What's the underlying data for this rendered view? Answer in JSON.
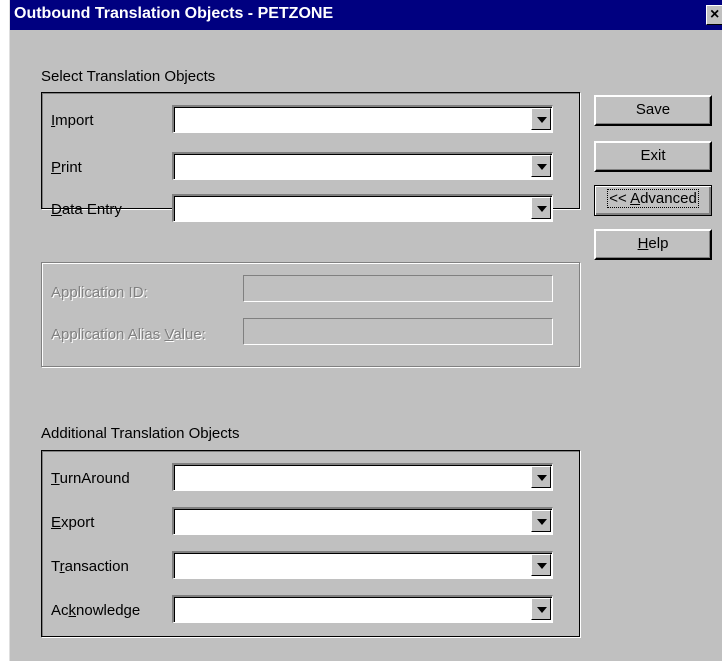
{
  "window": {
    "title": "Outbound Translation Objects - PETZONE",
    "close_glyph": "×"
  },
  "select_group": {
    "heading": "Select Translation Objects",
    "rows": [
      {
        "label_pre": "",
        "label_mnemonic": "I",
        "label_post": "mport",
        "value": ""
      },
      {
        "label_pre": "",
        "label_mnemonic": "P",
        "label_post": "rint",
        "value": ""
      },
      {
        "label_pre": "",
        "label_mnemonic": "D",
        "label_post": "ata Entry",
        "value": ""
      }
    ]
  },
  "application_group": {
    "app_id_label": "Application ID:",
    "alias_pre": "Application Alias ",
    "alias_mnemonic": "V",
    "alias_post": "alue:",
    "app_id_value": "",
    "alias_value": ""
  },
  "additional_group": {
    "heading": "Additional Translation Objects",
    "rows": [
      {
        "label_pre": "",
        "label_mnemonic": "T",
        "label_post": "urnAround",
        "value": ""
      },
      {
        "label_pre": "",
        "label_mnemonic": "E",
        "label_post": "xport",
        "value": ""
      },
      {
        "label_pre": "T",
        "label_mnemonic": "r",
        "label_post": "ansaction",
        "value": ""
      },
      {
        "label_pre": "Ac",
        "label_mnemonic": "k",
        "label_post": "nowledge",
        "value": ""
      }
    ]
  },
  "buttons": {
    "save": "Save",
    "exit": "Exit",
    "advanced_pre": "<< ",
    "advanced_mnemonic": "A",
    "advanced_post": "dvanced",
    "help_mnemonic": "H",
    "help_post": "elp"
  },
  "icons": {
    "dropdown": "triangle-down-icon"
  }
}
